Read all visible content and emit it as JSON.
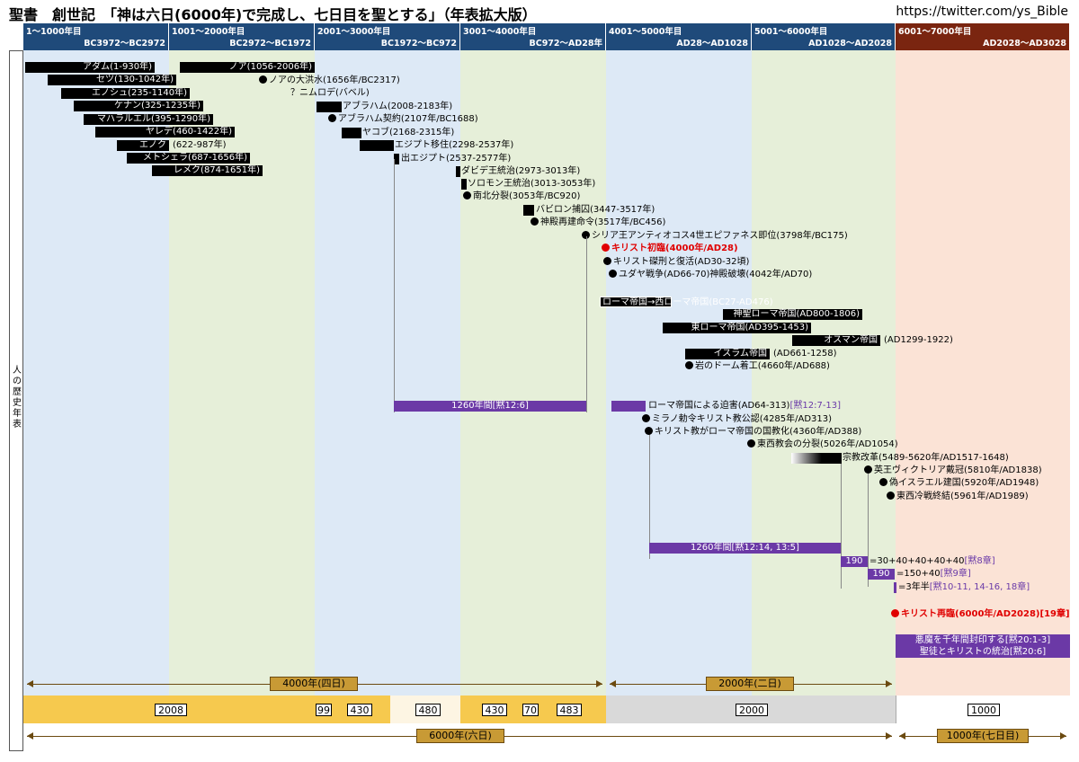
{
  "title": "聖書　創世記　「神は六日(6000年)で完成し、七日目を聖とする」（年表拡大版）",
  "url": "https://twitter.com/ys_Bible",
  "side_label": "人の歴史年表",
  "colors": {
    "blue": "#dde9f6",
    "green": "#e6efd9",
    "peach": "#fbe3d6",
    "header": "#1f4a7a",
    "header_last": "#7a2510",
    "purple": "#6b39a6",
    "gold": "#f6c94e"
  },
  "columns": [
    {
      "range": "1～1000年目",
      "era": "BC3972～BC2972"
    },
    {
      "range": "1001～2000年目",
      "era": "BC2972～BC1972"
    },
    {
      "range": "2001～3000年目",
      "era": "BC1972～BC972"
    },
    {
      "range": "3001～4000年目",
      "era": "BC972～AD28年"
    },
    {
      "range": "4001～5000年目",
      "era": "AD28～AD1028"
    },
    {
      "range": "5001～6000年目",
      "era": "AD1028～AD2028"
    },
    {
      "range": "6001～7000年目",
      "era": "AD2028～AD3028"
    }
  ],
  "patriarchs": [
    {
      "name": "アダム(1-930年)",
      "start": 1,
      "end": 930
    },
    {
      "name": "ノア(1056-2006年)",
      "start": 1056,
      "end": 2006
    },
    {
      "name": "セツ(130-1042年)",
      "start": 130,
      "end": 1042
    },
    {
      "name": "エノシュ(235-1140年)",
      "start": 235,
      "end": 1140
    },
    {
      "name": "ケナン(325-1235年)",
      "start": 325,
      "end": 1235
    },
    {
      "name": "マハラルエル(395-1290年)",
      "start": 395,
      "end": 1290
    },
    {
      "name": "ヤレデ(460-1422年)",
      "start": 460,
      "end": 1422
    },
    {
      "name": "エノク",
      "start": 622,
      "end": 987,
      "extra": "(622-987年)"
    },
    {
      "name": "メトシェラ(687-1656年)",
      "start": 687,
      "end": 1656
    },
    {
      "name": "レメク(874-1651年)",
      "start": 874,
      "end": 1651
    }
  ],
  "events": [
    {
      "text": "ノアの大洪水(1656年/BC2317)",
      "dot": true
    },
    {
      "text": "？ニムロデ(バベル)",
      "dot": false
    },
    {
      "text": "アブラハム(2008-2183年)",
      "dot": false
    },
    {
      "text": "アブラハム契約(2107年/BC1688)",
      "dot": true
    },
    {
      "text": "ヤコブ(2168-2315年)",
      "dot": false
    },
    {
      "text": "エジプト移住(2298-2537年)",
      "dot": false
    },
    {
      "text": "出エジプト(2537-2577年)",
      "dot": false
    },
    {
      "text": "ダビデ王統治(2973-3013年)",
      "dot": false
    },
    {
      "text": "ソロモン王統治(3013-3053年)",
      "dot": false
    },
    {
      "text": "南北分裂(3053年/BC920)",
      "dot": true
    },
    {
      "text": "バビロン捕囚(3447-3517年)",
      "dot": false
    },
    {
      "text": "神殿再建命令(3517年/BC456)",
      "dot": true
    },
    {
      "text": "シリア王アンティオコス4世エピファネス即位(3798年/BC175)",
      "dot": true
    },
    {
      "text": "キリスト初臨(4000年/AD28)",
      "dot": true,
      "red": true
    },
    {
      "text": "キリスト磔刑と復活(AD30-32頃)",
      "dot": true
    },
    {
      "text": "ユダヤ戦争(AD66-70)神殿破壊(4042年/AD70)",
      "dot": true
    }
  ],
  "empires": [
    {
      "text": "ローマ帝国→西ローマ帝国(BC27-AD476)"
    },
    {
      "text": "神聖ローマ帝国(AD800-1806)"
    },
    {
      "text": "東ローマ帝国(AD395-1453)"
    },
    {
      "text": "オスマン帝国",
      "extra": "(AD1299-1922)"
    },
    {
      "text": "イスラム帝国",
      "extra": "(AD661-1258)"
    },
    {
      "text": "岩のドーム着工(4660年/AD688)",
      "dot": true
    }
  ],
  "purple1": {
    "label": "1260年間[黙12:6]"
  },
  "church": [
    {
      "text": "ローマ帝国による迫害(AD64-313)",
      "ref": "[黙12:7-13]"
    },
    {
      "text": "ミラノ勅令キリスト教公認(4285年/AD313)",
      "dot": true
    },
    {
      "text": "キリスト教がローマ帝国の国教化(4360年/AD388)",
      "dot": true
    },
    {
      "text": "東西教会の分裂(5026年/AD1054)",
      "dot": true
    },
    {
      "text": "宗教改革(5489-5620年/AD1517-1648)"
    },
    {
      "text": "英王ヴィクトリア戴冠(5810年/AD1838)",
      "dot": true
    },
    {
      "text": "偽イスラエル建国(5920年/AD1948)",
      "dot": true
    },
    {
      "text": "東西冷戦終結(5961年/AD1989)",
      "dot": true
    }
  ],
  "purple2": {
    "label": "1260年間[黙12:14, 13:5]"
  },
  "p190a": {
    "num": "190",
    "eq": "=30+40+40+40+40",
    "ref": "[黙8章]"
  },
  "p190b": {
    "num": "190",
    "eq": "=150+40",
    "ref": "[黙9章]"
  },
  "p35": {
    "eq": "=3年半",
    "ref": "[黙10-11, 14-16, 18章]"
  },
  "second_coming": {
    "text": "キリスト再臨(6000年/AD2028)",
    "ref": "[19章]"
  },
  "millennium": {
    "line1": "悪魔を千年間封印する[黙20:1-3]",
    "line2": "聖徒とキリストの統治[黙20:6]"
  },
  "spans": {
    "four_days": "4000年(四日)",
    "two_days": "2000年(二日)",
    "six_days": "6000年(六日)",
    "seventh": "1000年(七日目)"
  },
  "blocks": [
    "2008",
    "99",
    "430",
    "480",
    "430",
    "70",
    "483",
    "2000",
    "1000"
  ]
}
